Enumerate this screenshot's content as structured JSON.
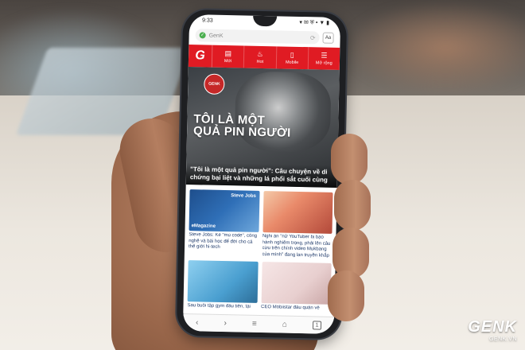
{
  "status": {
    "time": "9:33",
    "icons": "▾ ✉ ⛨ • ▼ ▮"
  },
  "browser": {
    "url": "GenK",
    "reader_label": "Aa"
  },
  "nav": {
    "logo": "G",
    "items": [
      {
        "label": "Mới",
        "icon": "document-icon",
        "glyph": "▤"
      },
      {
        "label": "Hot",
        "icon": "fire-icon",
        "glyph": "🔥"
      },
      {
        "label": "Mobile",
        "icon": "mobile-icon",
        "glyph": "▯"
      },
      {
        "label": "Mở rộng",
        "icon": "menu-icon",
        "glyph": "☰"
      }
    ]
  },
  "hero": {
    "badge": "GENK",
    "title_line1": "TÔI LÀ MỘT",
    "title_line2": "QUẢ PIN NGƯỜI",
    "caption": "\"Tôi là một quả pin người\": Câu chuyện về di chứng bại liệt và những lá phổi sắt cuối cùng"
  },
  "articles": [
    {
      "thumb_top": "Steve Jobs",
      "thumb_label": "eMagazine",
      "title": "Steve Jobs: Kẻ \"mù code\", công nghệ và bài học để đời cho cả thế giới hi-tech"
    },
    {
      "thumb_top": "",
      "thumb_label": "",
      "title": "Nghi án \"nữ YouTuber bị bạo hành nghiêm trọng, phải lên câu cừu trên chính video Mukbang của mình\" đang lan truyền khắp mạng xã hội"
    },
    {
      "thumb_top": "",
      "thumb_label": "",
      "title": "Sau buổi tập gym đầu tiên, tại"
    },
    {
      "thumb_top": "",
      "thumb_label": "",
      "title": "CEO Mobiistar đầu quân về"
    }
  ],
  "bottombar": {
    "back": "‹",
    "forward": "›",
    "menu": "≡",
    "home": "⌂",
    "tabs": "1"
  },
  "watermark": {
    "brand": "GENK",
    "url": "GENK.VN"
  },
  "colors": {
    "brand_red": "#e01b23"
  }
}
